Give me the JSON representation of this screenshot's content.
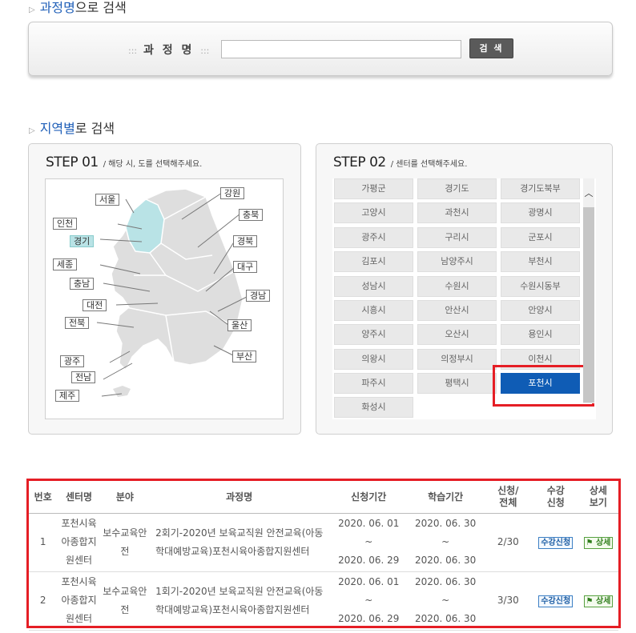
{
  "course_search": {
    "title_highlight": "과정명",
    "title_rest": "으로 검색",
    "label": "과 정 명",
    "label_dots_left": ":::",
    "label_dots_right": ":::",
    "input_value": "",
    "button_label": "검 색"
  },
  "region_search": {
    "title_highlight": "지역별",
    "title_rest": "로 검색"
  },
  "step1": {
    "heading": "STEP 01",
    "subtext": "/  해당 시, 도를 선택해주세요.",
    "regions": [
      "서울",
      "강원",
      "인천",
      "충북",
      "경기",
      "경북",
      "세종",
      "대구",
      "충남",
      "경남",
      "대전",
      "전북",
      "울산",
      "부산",
      "광주",
      "전남",
      "제주"
    ],
    "selected": "경기"
  },
  "step2": {
    "heading": "STEP 02",
    "subtext": "/  센터를 선택해주세요.",
    "cities": [
      "가평군",
      "경기도",
      "경기도북부",
      "고양시",
      "과천시",
      "광명시",
      "광주시",
      "구리시",
      "군포시",
      "김포시",
      "남양주시",
      "부천시",
      "성남시",
      "수원시",
      "수원시동부",
      "시흥시",
      "안산시",
      "안양시",
      "양주시",
      "오산시",
      "용인시",
      "의왕시",
      "의정부시",
      "이천시",
      "파주시",
      "평택시",
      "포천시",
      "화성시"
    ],
    "selected": "포천시"
  },
  "table": {
    "headers": [
      "번호",
      "센터명",
      "분야",
      "과정명",
      "신청기간",
      "학습기간",
      "신청/\n전체",
      "수강\n신청",
      "상세\n보기"
    ],
    "rows": [
      {
        "no": "1",
        "center": "포천시육아종합지원센터",
        "field": "보수교육안전",
        "course": "2회기-2020년 보육교직원 안전교육(아동학대예방교육)포천시육아종합지원센터",
        "apply_start": "2020. 06. 01",
        "apply_end": "2020. 06. 29",
        "study_start": "2020. 06. 30",
        "study_end": "2020. 06. 30",
        "tilde": "~",
        "count": "2/30",
        "apply_btn": "수강신청",
        "detail_btn": "상세"
      },
      {
        "no": "2",
        "center": "포천시육아종합지원센터",
        "field": "보수교육안전",
        "course": "1회기-2020년 보육교직원 안전교육(아동학대예방교육)포천시육아종합지원센터",
        "apply_start": "2020. 06. 01",
        "apply_end": "2020. 06. 29",
        "study_start": "2020. 06. 30",
        "study_end": "2020. 06. 30",
        "tilde": "~",
        "count": "3/30",
        "apply_btn": "수강신청",
        "detail_btn": "상세"
      }
    ]
  },
  "colors": {
    "accent_blue": "#1f5fb8",
    "selected_city": "#0f5cb5",
    "highlight_red": "#e51e25",
    "selected_region": "#b9e3e6"
  }
}
